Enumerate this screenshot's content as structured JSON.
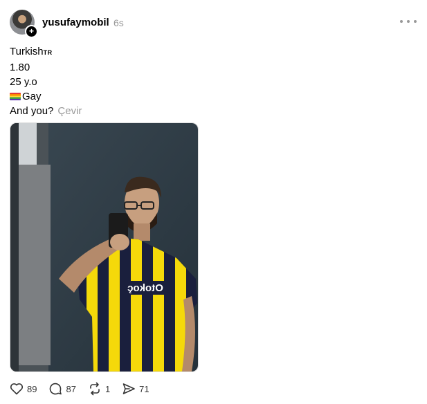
{
  "post": {
    "username": "yusufaymobil",
    "time": "6s",
    "lines": {
      "nationality": "Turkish",
      "nationality_code": "TR",
      "height": "1.80",
      "age": "25 y.o",
      "orientation": "Gay",
      "question": "And you?"
    },
    "translate_label": "Çevir",
    "image": {
      "jersey_text": "Otokoç"
    }
  },
  "actions": {
    "likes": "89",
    "replies": "87",
    "reposts": "1",
    "shares": "71"
  },
  "colors": {
    "jersey_yellow": "#f5d90a",
    "jersey_navy": "#1a1f3d",
    "muted_text": "#999999"
  },
  "icons": [
    "plus-icon",
    "more-icon",
    "heart-icon",
    "reply-icon",
    "repost-icon",
    "share-icon"
  ]
}
